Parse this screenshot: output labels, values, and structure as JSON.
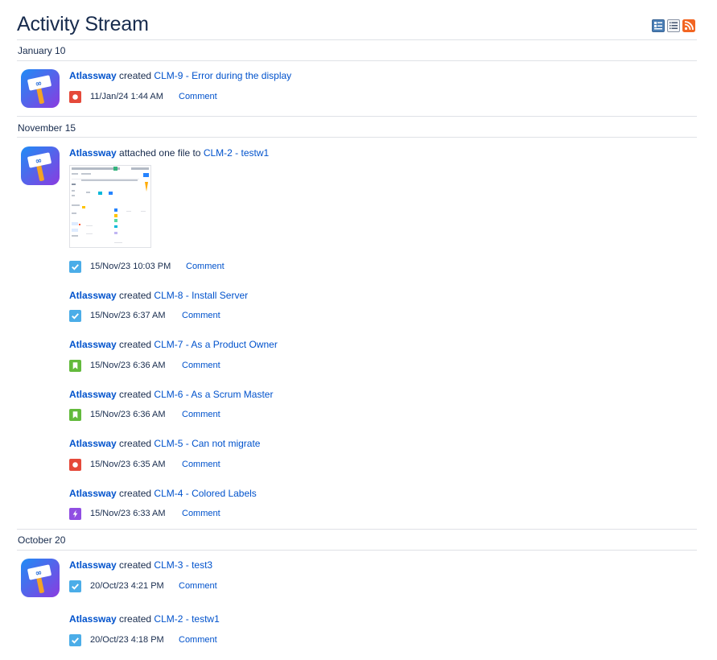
{
  "page": {
    "title": "Activity Stream"
  },
  "toolbar": {
    "buttons": [
      {
        "icon": "full-view-icon"
      },
      {
        "icon": "list-view-icon"
      },
      {
        "icon": "rss-feed-icon"
      }
    ]
  },
  "colors": {
    "link": "#0052cc",
    "text": "#172b4d",
    "divider": "#dfe1e6",
    "bug": "#e5493a",
    "task": "#4bade8",
    "story": "#63ba3c",
    "epic": "#904ee2",
    "rss": "#f26522",
    "view_button": "#4a7eb5"
  },
  "groups": [
    {
      "date": "January 10",
      "entries": [
        {
          "user": "Atlassway",
          "action": "created",
          "link": "CLM-9 - Error during the display",
          "issue_type": "bug",
          "timestamp": "11/Jan/24 1:44 AM",
          "comment": "Comment"
        }
      ]
    },
    {
      "date": "November 15",
      "entries": [
        {
          "user": "Atlassway",
          "action": "attached one file to",
          "link": "CLM-2 - testw1",
          "attachment": "file-thumbnail",
          "issue_type": "task",
          "timestamp": "15/Nov/23 10:03 PM",
          "comment": "Comment"
        },
        {
          "user": "Atlassway",
          "action": "created",
          "link": "CLM-8 - Install Server",
          "issue_type": "task",
          "timestamp": "15/Nov/23 6:37 AM",
          "comment": "Comment"
        },
        {
          "user": "Atlassway",
          "action": "created",
          "link": "CLM-7 - As a Product Owner",
          "issue_type": "story",
          "timestamp": "15/Nov/23 6:36 AM",
          "comment": "Comment"
        },
        {
          "user": "Atlassway",
          "action": "created",
          "link": "CLM-6 - As a Scrum Master",
          "issue_type": "story",
          "timestamp": "15/Nov/23 6:36 AM",
          "comment": "Comment"
        },
        {
          "user": "Atlassway",
          "action": "created",
          "link": "CLM-5 - Can not migrate",
          "issue_type": "bug",
          "timestamp": "15/Nov/23 6:35 AM",
          "comment": "Comment"
        },
        {
          "user": "Atlassway",
          "action": "created",
          "link": "CLM-4 - Colored Labels",
          "issue_type": "epic",
          "timestamp": "15/Nov/23 6:33 AM",
          "comment": "Comment"
        }
      ]
    },
    {
      "date": "October 20",
      "entries": [
        {
          "user": "Atlassway",
          "action": "created",
          "link": "CLM-3 - test3",
          "issue_type": "task",
          "timestamp": "20/Oct/23 4:21 PM",
          "comment": "Comment"
        },
        {
          "user": "Atlassway",
          "action": "created",
          "link": "CLM-2 - testw1",
          "issue_type": "task",
          "timestamp": "20/Oct/23 4:18 PM",
          "comment": "Comment"
        }
      ]
    }
  ]
}
